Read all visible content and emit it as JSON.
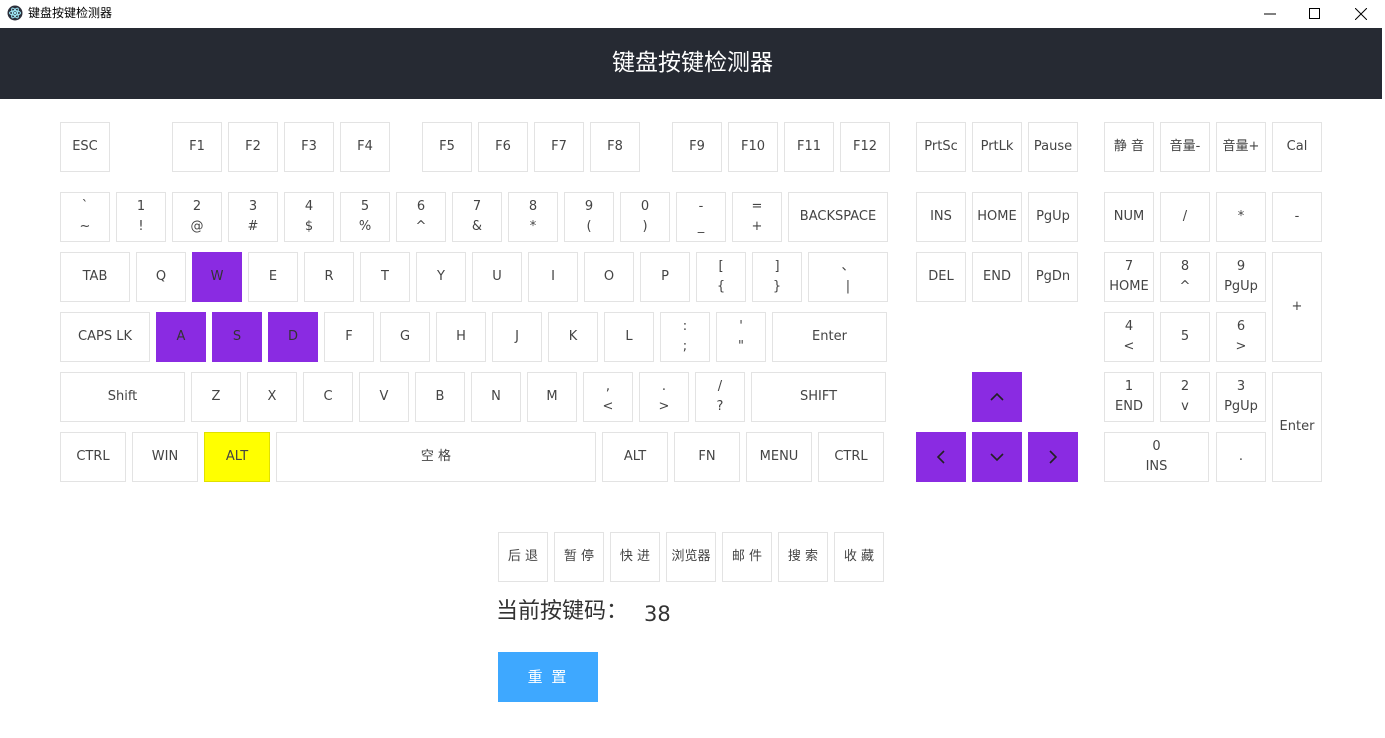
{
  "window": {
    "title": "键盘按键检测器"
  },
  "header": {
    "title": "键盘按键检测器"
  },
  "keys": [
    {
      "id": "esc",
      "l1": "ESC"
    },
    {
      "id": "f1",
      "l1": "F1"
    },
    {
      "id": "f2",
      "l1": "F2"
    },
    {
      "id": "f3",
      "l1": "F3"
    },
    {
      "id": "f4",
      "l1": "F4"
    },
    {
      "id": "f5",
      "l1": "F5"
    },
    {
      "id": "f6",
      "l1": "F6"
    },
    {
      "id": "f7",
      "l1": "F7"
    },
    {
      "id": "f8",
      "l1": "F8"
    },
    {
      "id": "f9",
      "l1": "F9"
    },
    {
      "id": "f10",
      "l1": "F10"
    },
    {
      "id": "f11",
      "l1": "F11"
    },
    {
      "id": "f12",
      "l1": "F12"
    },
    {
      "id": "prtsc",
      "l1": "PrtSc"
    },
    {
      "id": "prtlk",
      "l1": "PrtLk"
    },
    {
      "id": "pause",
      "l1": "Pause"
    },
    {
      "id": "mute",
      "l1": "静 音"
    },
    {
      "id": "vol-down",
      "l1": "音量-"
    },
    {
      "id": "vol-up",
      "l1": "音量+"
    },
    {
      "id": "cal",
      "l1": "Cal"
    },
    {
      "id": "backtick",
      "l1": "`",
      "l2": "~"
    },
    {
      "id": "digit1",
      "l1": "1",
      "l2": "!"
    },
    {
      "id": "digit2",
      "l1": "2",
      "l2": "@"
    },
    {
      "id": "digit3",
      "l1": "3",
      "l2": "#"
    },
    {
      "id": "digit4",
      "l1": "4",
      "l2": "$"
    },
    {
      "id": "digit5",
      "l1": "5",
      "l2": "%"
    },
    {
      "id": "digit6",
      "l1": "6",
      "l2": "^"
    },
    {
      "id": "digit7",
      "l1": "7",
      "l2": "&"
    },
    {
      "id": "digit8",
      "l1": "8",
      "l2": "*"
    },
    {
      "id": "digit9",
      "l1": "9",
      "l2": "("
    },
    {
      "id": "digit0",
      "l1": "0",
      "l2": ")"
    },
    {
      "id": "minus",
      "l1": "-",
      "l2": "_"
    },
    {
      "id": "equal",
      "l1": "=",
      "l2": "+"
    },
    {
      "id": "backspace",
      "l1": "BACKSPACE"
    },
    {
      "id": "ins",
      "l1": "INS"
    },
    {
      "id": "home",
      "l1": "HOME"
    },
    {
      "id": "pgup",
      "l1": "PgUp"
    },
    {
      "id": "numlock",
      "l1": "NUM"
    },
    {
      "id": "num-divide",
      "l1": "/"
    },
    {
      "id": "num-multiply",
      "l1": "*"
    },
    {
      "id": "num-subtract",
      "l1": "-"
    },
    {
      "id": "tab",
      "l1": "TAB"
    },
    {
      "id": "q",
      "l1": "Q"
    },
    {
      "id": "w",
      "l1": "W"
    },
    {
      "id": "e",
      "l1": "E"
    },
    {
      "id": "r",
      "l1": "R"
    },
    {
      "id": "t",
      "l1": "T"
    },
    {
      "id": "y",
      "l1": "Y"
    },
    {
      "id": "u",
      "l1": "U"
    },
    {
      "id": "i",
      "l1": "I"
    },
    {
      "id": "o",
      "l1": "O"
    },
    {
      "id": "p",
      "l1": "P"
    },
    {
      "id": "bracket-left",
      "l1": "[",
      "l2": "{"
    },
    {
      "id": "bracket-right",
      "l1": "]",
      "l2": "}"
    },
    {
      "id": "backslash",
      "l1": "、",
      "l2": "|"
    },
    {
      "id": "del",
      "l1": "DEL"
    },
    {
      "id": "end",
      "l1": "END"
    },
    {
      "id": "pgdn",
      "l1": "PgDn"
    },
    {
      "id": "num7",
      "l1": "7",
      "l2": "HOME"
    },
    {
      "id": "num8",
      "l1": "8",
      "l2": "^"
    },
    {
      "id": "num9",
      "l1": "9",
      "l2": "PgUp"
    },
    {
      "id": "num-add",
      "l1": "+"
    },
    {
      "id": "capslock",
      "l1": "CAPS LK"
    },
    {
      "id": "a",
      "l1": "A"
    },
    {
      "id": "s",
      "l1": "S"
    },
    {
      "id": "d",
      "l1": "D"
    },
    {
      "id": "f",
      "l1": "F"
    },
    {
      "id": "g",
      "l1": "G"
    },
    {
      "id": "h",
      "l1": "H"
    },
    {
      "id": "j",
      "l1": "J"
    },
    {
      "id": "k",
      "l1": "K"
    },
    {
      "id": "l",
      "l1": "L"
    },
    {
      "id": "semicolon",
      "l1": ":",
      "l2": ";"
    },
    {
      "id": "quote",
      "l1": "'",
      "l2": "\""
    },
    {
      "id": "enter",
      "l1": "Enter"
    },
    {
      "id": "num4",
      "l1": "4",
      "l2": "<"
    },
    {
      "id": "num5",
      "l1": "5"
    },
    {
      "id": "num6",
      "l1": "6",
      "l2": ">"
    },
    {
      "id": "shift-left",
      "l1": "Shift"
    },
    {
      "id": "z",
      "l1": "Z"
    },
    {
      "id": "x",
      "l1": "X"
    },
    {
      "id": "c",
      "l1": "C"
    },
    {
      "id": "v",
      "l1": "V"
    },
    {
      "id": "b",
      "l1": "B"
    },
    {
      "id": "n",
      "l1": "N"
    },
    {
      "id": "m",
      "l1": "M"
    },
    {
      "id": "comma",
      "l1": ",",
      "l2": "<"
    },
    {
      "id": "period",
      "l1": ".",
      "l2": ">"
    },
    {
      "id": "slash",
      "l1": "/",
      "l2": "?"
    },
    {
      "id": "shift-right",
      "l1": "SHIFT"
    },
    {
      "id": "arrow-up",
      "l1": ""
    },
    {
      "id": "num1",
      "l1": "1",
      "l2": "END"
    },
    {
      "id": "num2",
      "l1": "2",
      "l2": "v"
    },
    {
      "id": "num3",
      "l1": "3",
      "l2": "PgUp"
    },
    {
      "id": "num-enter",
      "l1": "Enter"
    },
    {
      "id": "ctrl-left",
      "l1": "CTRL"
    },
    {
      "id": "win",
      "l1": "WIN"
    },
    {
      "id": "alt-left",
      "l1": "ALT"
    },
    {
      "id": "space",
      "l1": "空 格"
    },
    {
      "id": "alt-right",
      "l1": "ALT"
    },
    {
      "id": "fn",
      "l1": "FN"
    },
    {
      "id": "menu",
      "l1": "MENU"
    },
    {
      "id": "ctrl-right",
      "l1": "CTRL"
    },
    {
      "id": "arrow-left",
      "l1": ""
    },
    {
      "id": "arrow-down",
      "l1": ""
    },
    {
      "id": "arrow-right",
      "l1": ""
    },
    {
      "id": "num0",
      "l1": "0",
      "l2": "INS"
    },
    {
      "id": "num-decimal",
      "l1": "."
    },
    {
      "id": "browser-back",
      "l1": "后 退"
    },
    {
      "id": "media-pause",
      "l1": "暂 停"
    },
    {
      "id": "media-forward",
      "l1": "快 进"
    },
    {
      "id": "browser",
      "l1": "浏览器"
    },
    {
      "id": "mail",
      "l1": "邮 件"
    },
    {
      "id": "search",
      "l1": "搜 索"
    },
    {
      "id": "favorites",
      "l1": "收 藏"
    }
  ],
  "highlighted": {
    "purple": [
      "w",
      "a",
      "s",
      "d",
      "arrow-up",
      "arrow-left",
      "arrow-down",
      "arrow-right"
    ],
    "yellow": [
      "alt-left"
    ]
  },
  "colors": {
    "header": "#262a33",
    "pressed": "#8a2be2",
    "last_pressed": "#ffff00",
    "reset": "#3ea8ff"
  },
  "keycode": {
    "label": "当前按键码：",
    "value": "38"
  },
  "reset_button": {
    "label": "重 置"
  }
}
